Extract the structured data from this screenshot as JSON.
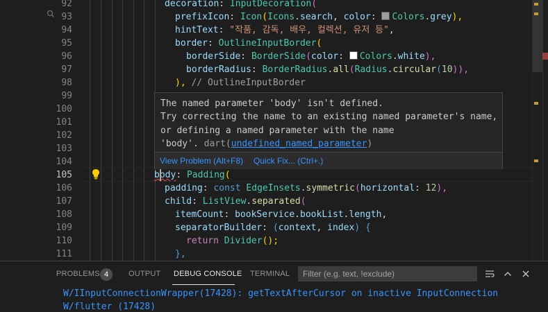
{
  "editor": {
    "line_numbers": [
      "92",
      "93",
      "94",
      "95",
      "96",
      "97",
      "98",
      "99",
      "100",
      "101",
      "102",
      "103",
      "104",
      "105",
      "106",
      "107",
      "108",
      "109",
      "110",
      "111"
    ],
    "active_line": "105",
    "lines": {
      "l92": {
        "t1": "decoration",
        "t2": ": ",
        "t3": "InputDecoration",
        "t4": "("
      },
      "l93": {
        "t1": "prefixIcon",
        "t2": ": ",
        "t3": "Icon",
        "t4": "(",
        "t5": "Icons",
        "t6": ".",
        "t7": "search",
        ",": ", ",
        "t8": "color",
        "t9": ": ",
        "t10": "Colors",
        "t11": ".",
        "t12": "grey",
        "t13": "),"
      },
      "l94": {
        "t1": "hintText",
        "t2": ": ",
        "t3": "\"작품, 감독, 배우, 컬렉션, 유저 등\"",
        "t4": ","
      },
      "l95": {
        "t1": "border",
        "t2": ": ",
        "t3": "OutlineInputBorder",
        "t4": "("
      },
      "l96": {
        "t1": "borderSide",
        "t2": ": ",
        "t3": "BorderSide",
        "t4": "(",
        "t5": "color",
        "t6": ": ",
        "t7": "Colors",
        "t8": ".",
        "t9": "white",
        "t10": "),"
      },
      "l97": {
        "t1": "borderRadius",
        "t2": ": ",
        "t3": "BorderRadius",
        "t4": ".",
        "t5": "all",
        "t6": "(",
        "t7": "Radius",
        "t8": ".",
        "t9": "circular",
        "t10": "(",
        "t11": "10",
        "t12": ")),"
      },
      "l98": {
        "t1": "),",
        "t2": " // OutlineInputBorder"
      },
      "l105": {
        "t1": "body",
        "t2": ": ",
        "t3": "Padding",
        "t4": "("
      },
      "l106": {
        "t1": "padding",
        "t2": ": ",
        "t3": "const",
        "t4": " ",
        "t5": "EdgeInsets",
        "t6": ".",
        "t7": "symmetric",
        "t8": "(",
        "t9": "horizontal",
        "t10": ": ",
        "t11": "12",
        "t12": "),"
      },
      "l107": {
        "t1": "child",
        "t2": ": ",
        "t3": "ListView",
        "t4": ".",
        "t5": "separated",
        "t6": "("
      },
      "l108": {
        "t1": "itemCount",
        "t2": ": ",
        "t3": "bookService",
        "t4": ".",
        "t5": "bookList",
        "t6": ".",
        "t7": "length",
        "t8": ","
      },
      "l109": {
        "t1": "separatorBuilder",
        "t2": ": ",
        "t3": "(",
        "t4": "context",
        "t5": ", ",
        "t6": "index",
        "t7": ") {"
      },
      "l110": {
        "t1": "return",
        "t2": " ",
        "t3": "Divider",
        "t4": "();"
      },
      "l111": {
        "t1": "},"
      }
    },
    "colors": {
      "grey_swatch": "#9e9e9e",
      "white_swatch": "#ffffff"
    }
  },
  "hover": {
    "line1": "The named parameter 'body' isn't defined.",
    "line2": "Try correcting the name to an existing named parameter's name,",
    "line3": "or defining a named parameter with the name",
    "line4a": "'body'. ",
    "line4b": "dart(",
    "line4c": "undefined_named_parameter",
    "line4d": ")",
    "view_problem": "View Problem (Alt+F8)",
    "quick_fix": "Quick Fix... (Ctrl+.)"
  },
  "panel": {
    "tabs": {
      "problems": "PROBLEMS",
      "output": "OUTPUT",
      "debug_console": "DEBUG CONSOLE",
      "terminal": "TERMINAL"
    },
    "problems_count": "4",
    "filter_placeholder": "Filter (e.g. text, !exclude)",
    "console_line1": "W/IInputConnectionWrapper(17428): getTextAfterCursor on inactive InputConnection",
    "console_line2": "W/flutter (17428)"
  }
}
